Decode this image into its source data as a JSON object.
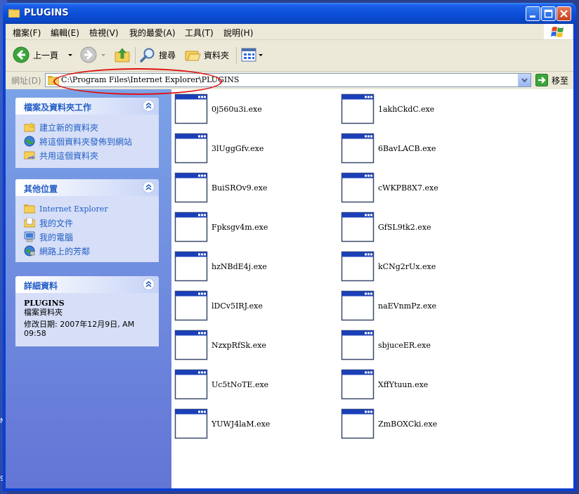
{
  "window": {
    "title": "PLUGINS",
    "frame_color": "#0a3fd0"
  },
  "menubar": {
    "items": [
      "檔案(F)",
      "編輯(E)",
      "檢視(V)",
      "我的最愛(A)",
      "工具(T)",
      "說明(H)"
    ]
  },
  "toolbar": {
    "back_label": "上一頁",
    "search_label": "搜尋",
    "folders_label": "資料夾"
  },
  "address": {
    "label": "網址(D)",
    "value": "C:\\Program Files\\Internet Explorer\\PLUGINS",
    "go_label": "移至"
  },
  "panels": {
    "tasks": {
      "title": "檔案及資料夾工作",
      "items": [
        "建立新的資料夾",
        "將這個資料夾發佈到網站",
        "共用這個資料夾"
      ]
    },
    "places": {
      "title": "其他位置",
      "items": [
        "Internet Explorer",
        "我的文件",
        "我的電腦",
        "網路上的芳鄰"
      ]
    },
    "details": {
      "title": "詳細資料",
      "name": "PLUGINS",
      "type": "檔案資料夾",
      "modified_line1": "修改日期: 2007年12月9日, AM",
      "modified_line2": "09:58"
    }
  },
  "files": [
    "0j560u3i.exe",
    "1akhCkdC.exe",
    "3lUggGfv.exe",
    "6BavLACB.exe",
    "BuiSROv9.exe",
    "cWKPB8X7.exe",
    "Fpksgv4m.exe",
    "GfSL9tk2.exe",
    "hzNBdE4j.exe",
    "kCNg2rUx.exe",
    "lDCv5IRJ.exe",
    "naEVnmPz.exe",
    "NzxpRfSk.exe",
    "sbjuceER.exe",
    "Uc5tNoTE.exe",
    "XffYtuun.exe",
    "YUWJ4laM.exe",
    "ZmBOXCki.exe"
  ],
  "desktop_edge_chars": [
    "N",
    "9"
  ]
}
